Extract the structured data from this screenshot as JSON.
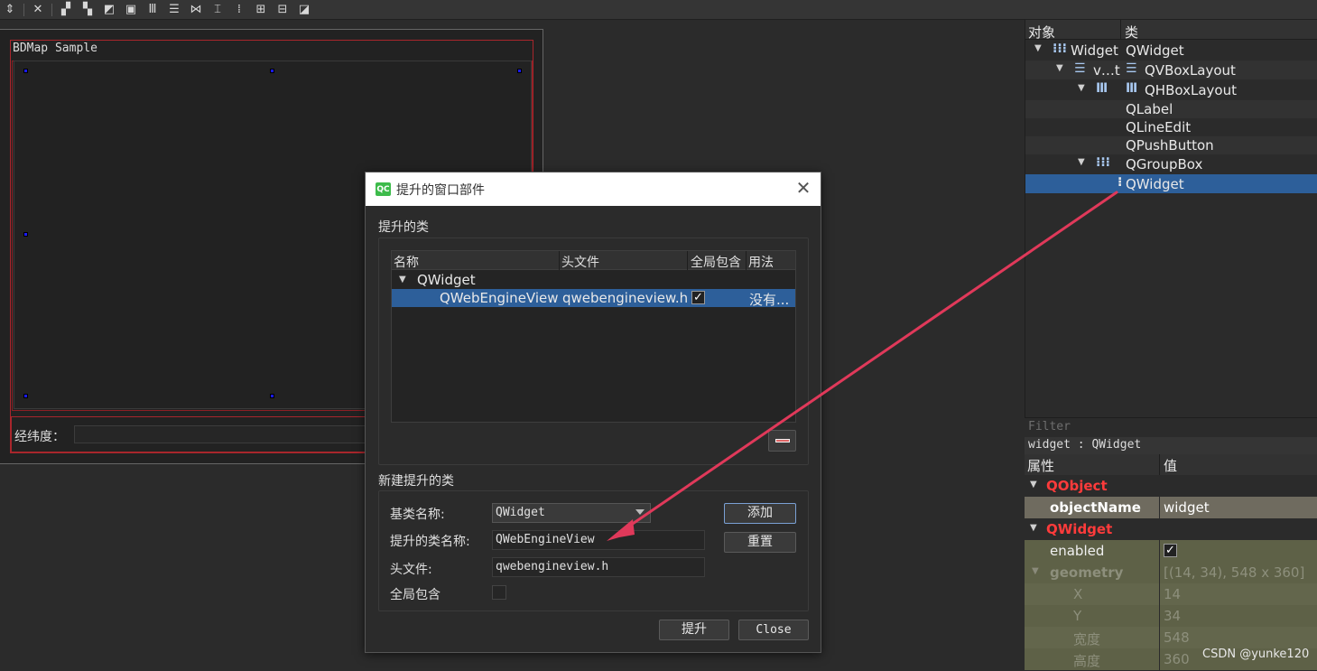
{
  "toolbar": {
    "icons": [
      "adjust-size-icon",
      "close-icon",
      "edit-widgets-icon",
      "edit-signals-icon",
      "edit-buddies-icon",
      "edit-tab-order-icon",
      "layout-horizontal-icon",
      "layout-vertical-icon",
      "splitter-horizontal-icon",
      "splitter-vertical-icon",
      "layout-form-icon",
      "layout-grid-icon",
      "break-layout-icon",
      "adjust-size-2-icon"
    ]
  },
  "form": {
    "title": "BDMap Sample",
    "lnglat_label": "经纬度："
  },
  "object_inspector": {
    "header": {
      "col1": "对象",
      "col2": "类"
    },
    "rows": [
      {
        "object": "Widget",
        "class": "QWidget"
      },
      {
        "object": "v…t",
        "class": "QVBoxLayout"
      },
      {
        "object": "",
        "class": "QHBoxLayout"
      },
      {
        "object": "",
        "class": "QLabel"
      },
      {
        "object": "",
        "class": "QLineEdit"
      },
      {
        "object": "",
        "class": "QPushButton"
      },
      {
        "object": "",
        "class": "QGroupBox"
      },
      {
        "object": "",
        "class": "QWidget"
      }
    ]
  },
  "property_editor": {
    "filter_placeholder": "Filter",
    "class_info": "widget : QWidget",
    "header": {
      "col1": "属性",
      "col2": "值"
    },
    "rows": [
      {
        "name": "QObject",
        "value": ""
      },
      {
        "name": "objectName",
        "value": "widget"
      },
      {
        "name": "QWidget",
        "value": ""
      },
      {
        "name": "enabled",
        "value": "✓"
      },
      {
        "name": "geometry",
        "value": "[(14, 34), 548 x 360]"
      },
      {
        "name": "X",
        "value": "14"
      },
      {
        "name": "Y",
        "value": "34"
      },
      {
        "name": "宽度",
        "value": "548"
      },
      {
        "name": "高度",
        "value": "360"
      }
    ]
  },
  "dialog": {
    "icon_text": "QC",
    "title": "提升的窗口部件",
    "promoted_section": "提升的类",
    "table": {
      "headers": [
        "名称",
        "头文件",
        "全局包含",
        "用法"
      ],
      "group": "QWidget",
      "row": {
        "name": "QWebEngineView",
        "header": "qwebengineview.h",
        "global": "✓",
        "usage": "没有..."
      }
    },
    "new_section": "新建提升的类",
    "base_class_label": "基类名称:",
    "base_class_value": "QWidget",
    "promoted_name_label": "提升的类名称:",
    "promoted_name_value": "QWebEngineView",
    "header_file_label": "头文件:",
    "header_file_value": "qwebengineview.h",
    "global_include_label": "全局包含",
    "add_button": "添加",
    "reset_button": "重置",
    "promote_button": "提升",
    "close_button": "Close"
  },
  "watermark": "CSDN @yunke120",
  "colors": {
    "selection": "#2d5f9a",
    "arrow": "#e0395a",
    "form_border": "#a8262c",
    "class_heading": "#ff3b3b"
  }
}
